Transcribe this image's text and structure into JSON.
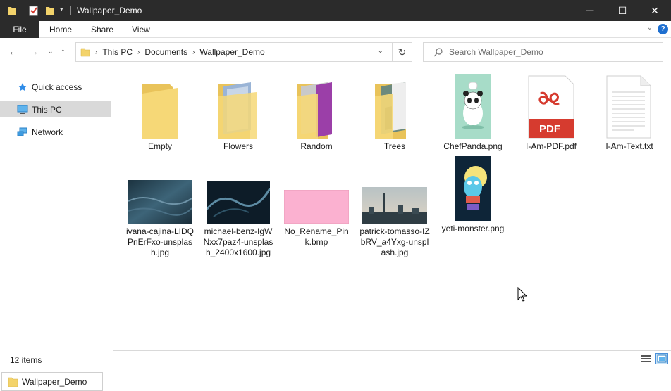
{
  "window": {
    "title": "Wallpaper_Demo",
    "minimize_glyph": "—",
    "maximize_glyph": "☐",
    "close_glyph": "✕"
  },
  "ribbon": {
    "file": "File",
    "tabs": [
      "Home",
      "Share",
      "View"
    ],
    "help": "?"
  },
  "nav": {
    "breadcrumbs": [
      "This PC",
      "Documents",
      "Wallpaper_Demo"
    ],
    "search_placeholder": "Search Wallpaper_Demo"
  },
  "sidebar": {
    "items": [
      {
        "label": "Quick access",
        "icon": "star-icon"
      },
      {
        "label": "This PC",
        "icon": "computer-icon"
      },
      {
        "label": "Network",
        "icon": "network-icon"
      }
    ]
  },
  "files": [
    {
      "name": "Empty",
      "kind": "folder-empty"
    },
    {
      "name": "Flowers",
      "kind": "folder-flowers"
    },
    {
      "name": "Random",
      "kind": "folder-random"
    },
    {
      "name": "Trees",
      "kind": "folder-trees"
    },
    {
      "name": "ChefPanda.png",
      "kind": "image-panda"
    },
    {
      "name": "I-Am-PDF.pdf",
      "kind": "pdf"
    },
    {
      "name": "I-Am-Text.txt",
      "kind": "text"
    },
    {
      "name": "ivana-cajina-LIDQPnErFxo-unsplash.jpg",
      "kind": "image-ocean"
    },
    {
      "name": "michael-benz-IgWNxx7paz4-unsplash_2400x1600.jpg",
      "kind": "image-wave"
    },
    {
      "name": "No_Rename_Pink.bmp",
      "kind": "image-pink"
    },
    {
      "name": "patrick-tomasso-IZbRV_a4Yxg-unsplash.jpg",
      "kind": "image-city"
    },
    {
      "name": "yeti-monster.png",
      "kind": "image-yeti"
    }
  ],
  "pdf_badge": "PDF",
  "status": {
    "item_count": "12 items"
  },
  "taskbar": {
    "label": "Wallpaper_Demo"
  },
  "colors": {
    "folder": "#f3d36b",
    "selection": "#d9d9d9",
    "accent": "#1e6fd0",
    "pdf_red": "#d63b2f"
  }
}
